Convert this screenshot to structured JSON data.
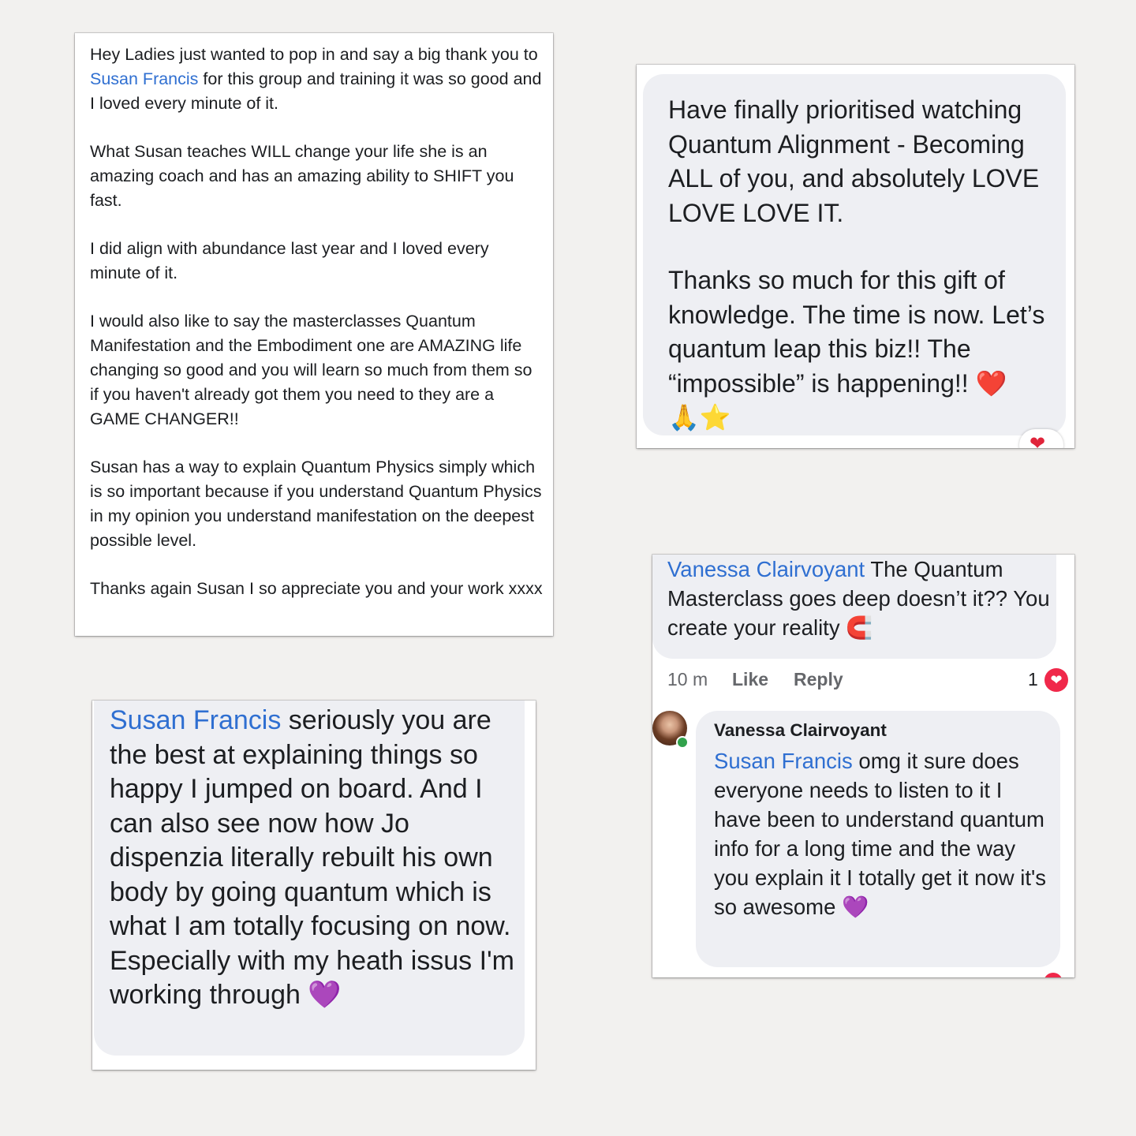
{
  "card1": {
    "p1_pre": "Hey Ladies just wanted to pop in and say a big thank you to ",
    "p1_mention": "Susan Francis",
    "p1_post": " for this group and training it was so good and I loved every minute of it.",
    "p2": "What Susan teaches WILL change your life she is an amazing coach and has an amazing ability to SHIFT you fast.",
    "p3": "I did align with abundance last year and I loved every minute of it.",
    "p4": "I would also like to say the masterclasses Quantum Manifestation and the Embodiment one are AMAZING life changing so good and you will learn so much from them so if you haven't already got them you need to they are a GAME CHANGER!!",
    "p5": "Susan has a way to explain Quantum Physics simply which is so important because if you understand Quantum Physics in my opinion you understand manifestation on the deepest possible level.",
    "p6": "Thanks again Susan I so appreciate you and your work xxxx"
  },
  "card2": {
    "p1": "Have finally prioritised watching Quantum Alignment - Becoming ALL of you, and absolutely LOVE LOVE LOVE IT.",
    "p2": "Thanks so much for this gift of knowledge. The time is now. Let’s quantum leap this biz!! The “impossible” is happening!!",
    "emoji_heart": "❤️",
    "emoji_pray_star": "🙏⭐",
    "reaction": "❤"
  },
  "card3": {
    "mention": "Susan Francis",
    "text": " seriously you are the best at explaining things so happy I jumped on board. And I can also see now how Jo dispenzia literally rebuilt his own body by going quantum which is what I am totally focusing on now. Especially with my heath issus I'm working through",
    "emoji": "💜"
  },
  "card4": {
    "comment_mention": "Vanessa Clairvoyant",
    "comment_text": " The Quantum Masterclass goes deep doesn’t it?? You create your reality",
    "comment_emoji": "🧲",
    "time": "10 m",
    "like": "Like",
    "reply": "Reply",
    "reaction_count": "1",
    "reaction_icon": "❤",
    "reply_author": "Vanessa Clairvoyant",
    "reply_mention": "Susan Francis",
    "reply_text": " omg it sure does everyone needs to listen to it I have been to understand quantum info for a long time and the way you explain it I totally get it now it's so awesome",
    "reply_emoji": "💜"
  }
}
